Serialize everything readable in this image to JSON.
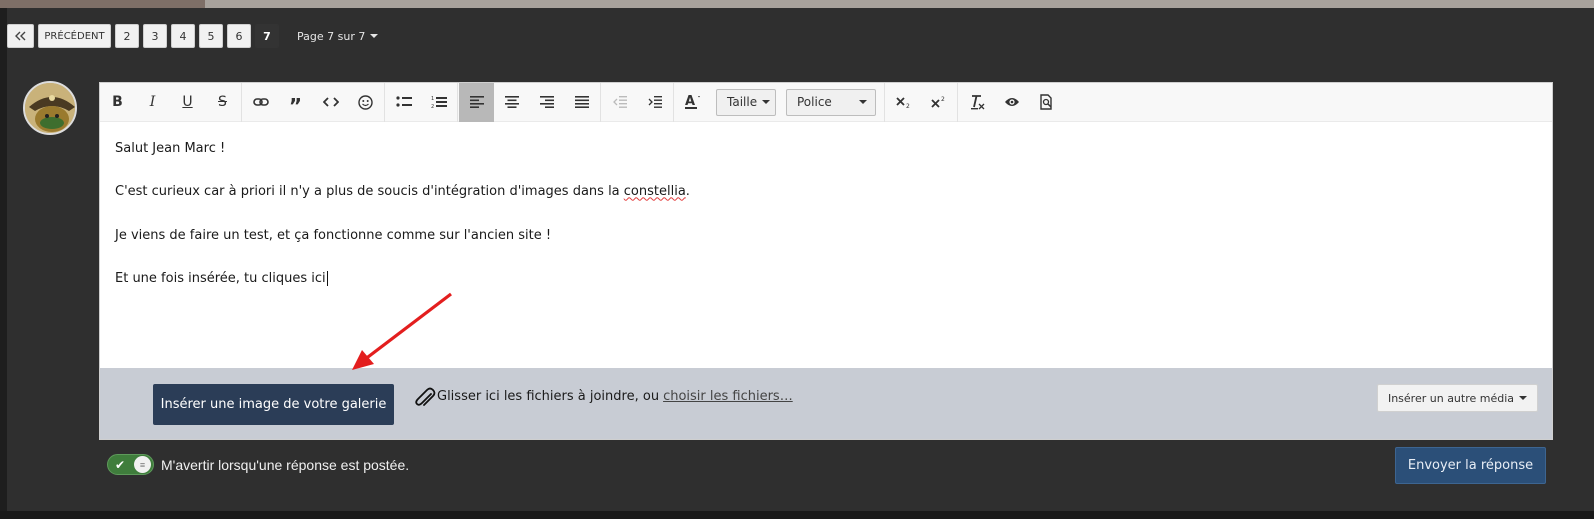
{
  "pagination": {
    "first_icon": "double-chevron-left-icon",
    "prev_label": "PRÉCÉDENT",
    "pages": [
      "2",
      "3",
      "4",
      "5",
      "6",
      "7"
    ],
    "current_page": "7",
    "page_info": "Page 7 sur 7"
  },
  "toolbar": {
    "size_label": "Taille",
    "font_label": "Police",
    "buttons": [
      "bold",
      "italic",
      "underline",
      "strikethrough",
      "link",
      "quote",
      "code",
      "emoji",
      "bulleted-list",
      "numbered-list",
      "align-left",
      "align-center",
      "align-right",
      "justify",
      "outdent",
      "indent",
      "text-color",
      "font-size",
      "font-family",
      "subscript",
      "superscript",
      "clear-format",
      "preview",
      "source-preview"
    ],
    "active_button": "align-left"
  },
  "editor": {
    "lines": [
      "Salut Jean Marc !",
      "C'est curieux car à priori il n'y a plus de soucis d'intégration d'images dans la ",
      "Je viens de faire un test, et ça fonctionne comme sur l'ancien site !",
      "Et une fois insérée, tu cliques ici"
    ],
    "misspelled_word": "constellia",
    "after_misspelled": "."
  },
  "attachments": {
    "gallery_button": "Insérer une image de votre galerie",
    "drop_text": "Glisser ici les fichiers à joindre, ou",
    "choose_link": "choisir les fichiers…",
    "other_media_button": "Insérer un autre média"
  },
  "footer": {
    "notify_label": "M'avertir lorsqu'une réponse est postée.",
    "notify_enabled": true,
    "send_button": "Envoyer la réponse"
  },
  "colors": {
    "primary_button": "#2b3d57",
    "send_button": "#2b4f78",
    "toggle_on": "#3f7d3c",
    "annotation_arrow": "#e31e1e",
    "attach_bar": "#c8ccd4"
  }
}
